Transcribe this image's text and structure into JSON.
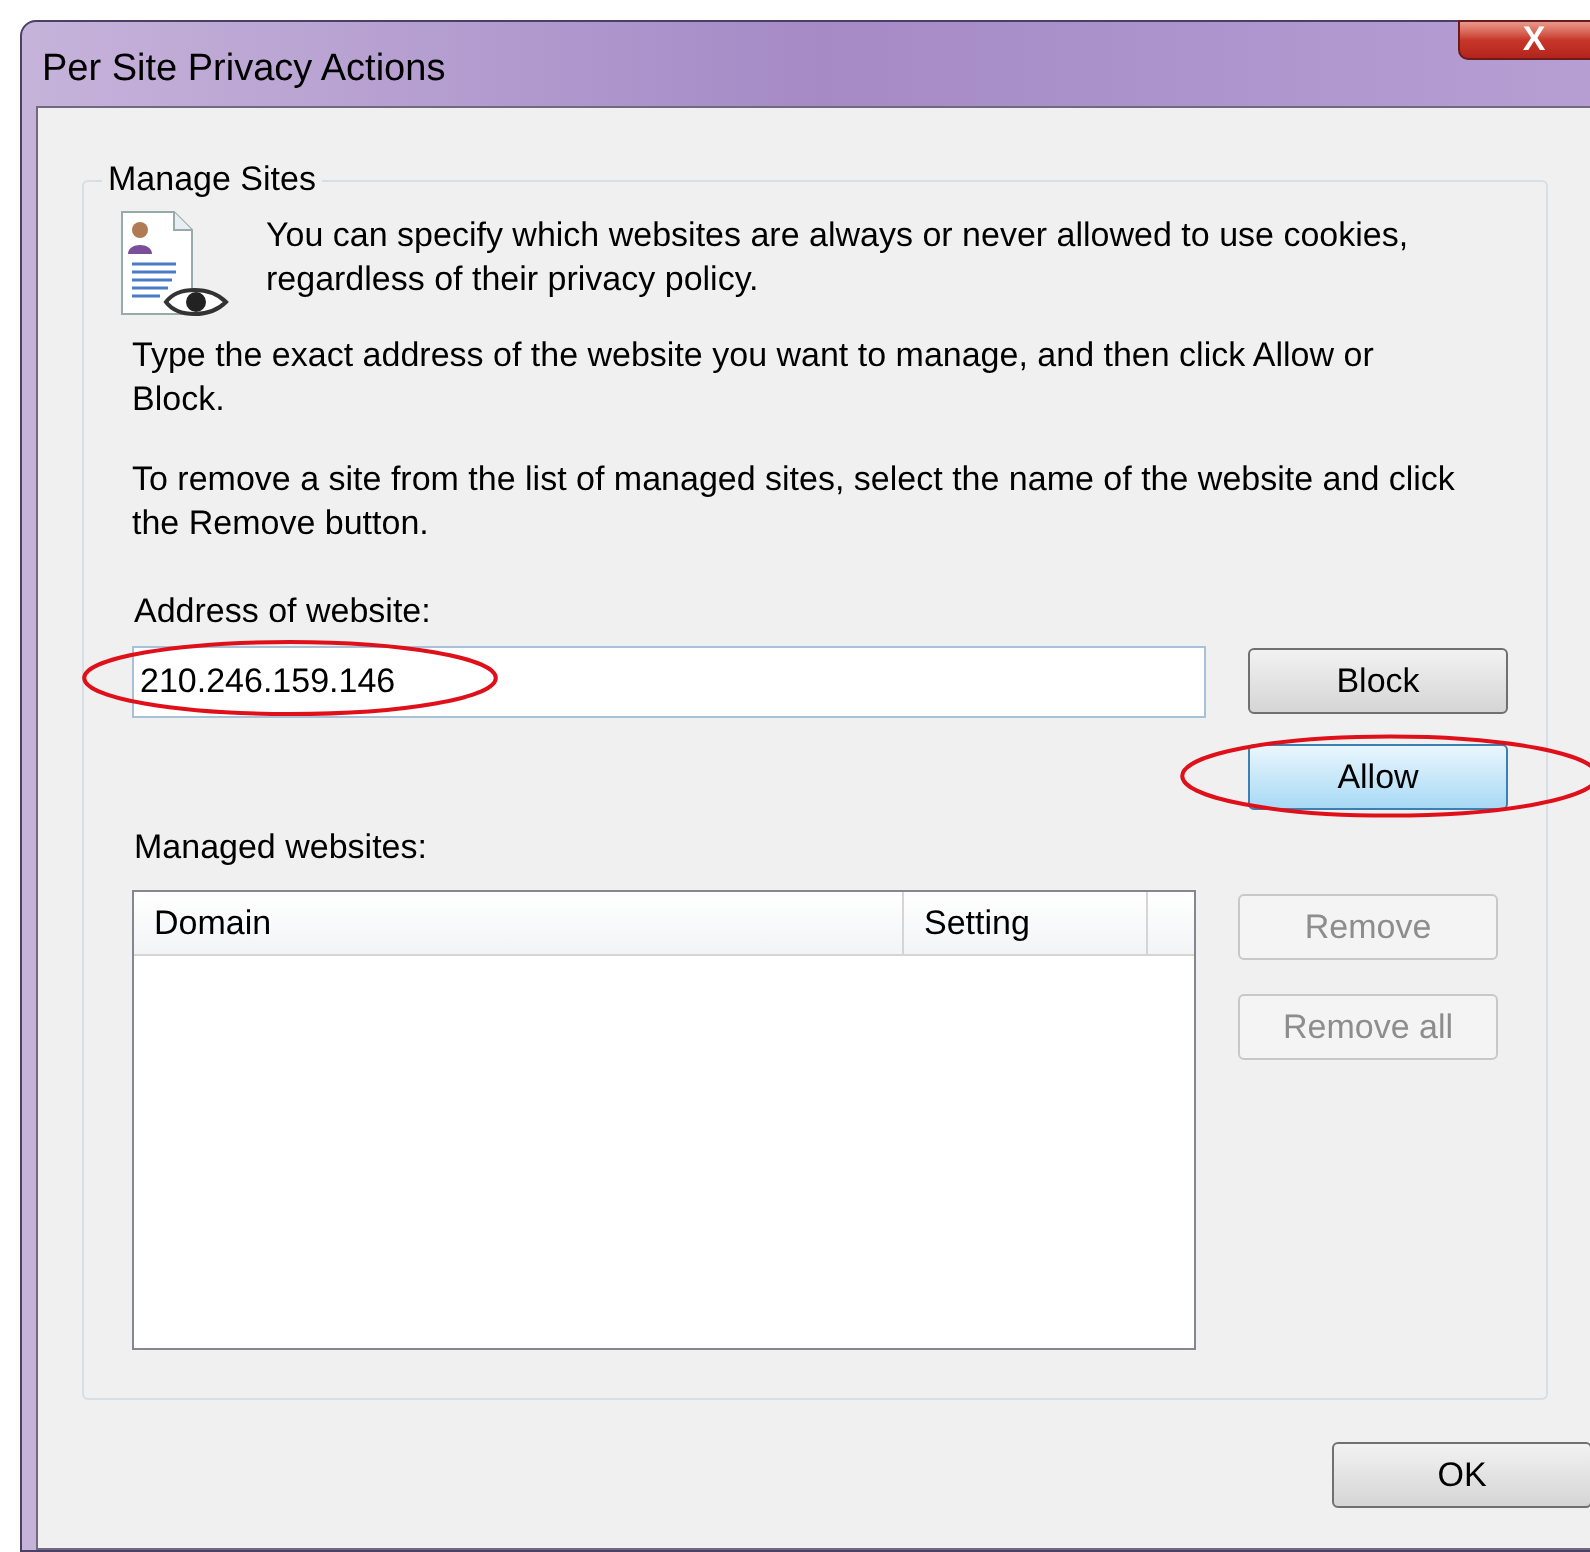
{
  "window": {
    "title": "Per Site Privacy Actions",
    "close": "X"
  },
  "group": {
    "title": "Manage Sites",
    "intro": "You can specify which websites are always or never allowed to use cookies, regardless of their privacy policy.",
    "paragraphs": [
      "Type the exact address of the website you want to manage, and then click Allow or Block.",
      "To remove a site from the list of managed sites, select the name of the website and click the Remove button."
    ]
  },
  "address": {
    "label": "Address of website:",
    "value": "210.246.159.146",
    "highlighted": true
  },
  "site_buttons": [
    {
      "label": "Block",
      "focused": false,
      "highlighted": false
    },
    {
      "label": "Allow",
      "focused": true,
      "highlighted": true
    }
  ],
  "managed": {
    "label": "Managed websites:",
    "columns": [
      "Domain",
      "Setting"
    ]
  },
  "list_buttons": [
    {
      "label": "Remove",
      "disabled": true
    },
    {
      "label": "Remove all",
      "disabled": true
    }
  ],
  "ok": "OK"
}
